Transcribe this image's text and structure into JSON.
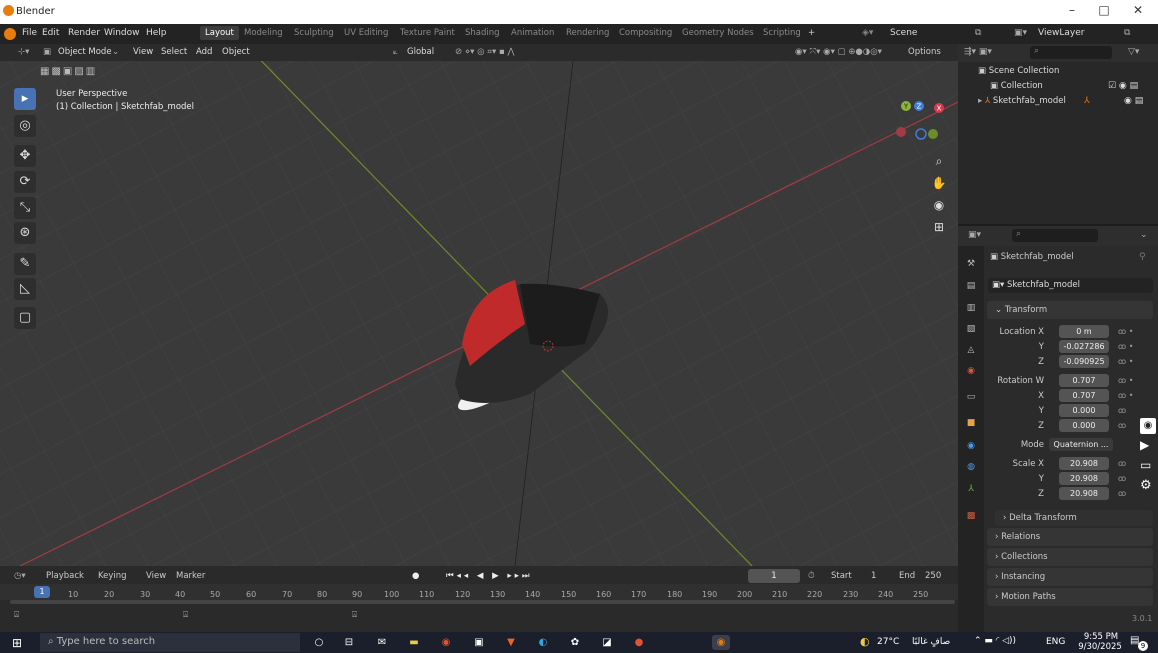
{
  "app": {
    "title": "Blender",
    "version": "3.0.1"
  },
  "window_controls": [
    "–",
    "□",
    "✕"
  ],
  "menu": {
    "items": [
      "File",
      "Edit",
      "Render",
      "Window",
      "Help"
    ]
  },
  "workspaces": [
    "Layout",
    "Modeling",
    "Sculpting",
    "UV Editing",
    "Texture Paint",
    "Shading",
    "Animation",
    "Rendering",
    "Compositing",
    "Geometry Nodes",
    "Scripting",
    "+"
  ],
  "scene": {
    "label": "Scene",
    "viewlayer": "ViewLayer"
  },
  "viewport_header": {
    "mode": "Object Mode",
    "menus": [
      "View",
      "Select",
      "Add",
      "Object"
    ],
    "orientation": "Global",
    "options": "Options"
  },
  "viewport": {
    "perspective": "User Perspective",
    "collection_info": "(1) Collection | Sketchfab_model",
    "gizmo": {
      "x": "X",
      "y": "Y",
      "z": "Z"
    }
  },
  "timeline": {
    "menus": [
      "Playback",
      "Keying",
      "View",
      "Marker"
    ],
    "current_frame": "1",
    "start_label": "Start",
    "start": "1",
    "end_label": "End",
    "end": "250",
    "ticks": [
      "10",
      "20",
      "30",
      "40",
      "50",
      "60",
      "70",
      "80",
      "90",
      "100",
      "110",
      "120",
      "130",
      "140",
      "150",
      "160",
      "170",
      "180",
      "190",
      "200",
      "210",
      "220",
      "230",
      "240",
      "250"
    ],
    "playhead": "1"
  },
  "outliner": {
    "root": "Scene Collection",
    "items": [
      {
        "label": "Collection"
      },
      {
        "label": "Sketchfab_model"
      }
    ]
  },
  "properties": {
    "object_name": "Sketchfab_model",
    "data_name": "Sketchfab_model",
    "transform_label": "Transform",
    "location_x_label": "Location X",
    "location": {
      "x": "0 m",
      "y": "-0.027286",
      "z": "-0.090925"
    },
    "rotation_w_label": "Rotation W",
    "rotation": {
      "w": "0.707",
      "x": "0.707",
      "y": "0.000",
      "z": "0.000"
    },
    "mode_label": "Mode",
    "mode": "Quaternion ...",
    "scale_x_label": "Scale X",
    "scale": {
      "x": "20.908",
      "y": "20.908",
      "z": "20.908"
    },
    "axis_labels": {
      "y": "Y",
      "z": "Z",
      "x": "X"
    },
    "sections": [
      "Delta Transform",
      "Relations",
      "Collections",
      "Instancing",
      "Motion Paths"
    ]
  },
  "taskbar": {
    "search_placeholder": "Type here to search",
    "weather": "27°C",
    "weather_text": "صافٍ غالبًا",
    "lang": "ENG",
    "time": "9:55 PM",
    "date": "9/30/2025",
    "notifications": "9"
  }
}
